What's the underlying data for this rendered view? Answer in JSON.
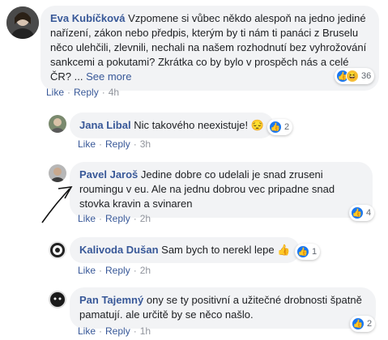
{
  "actions": {
    "like": "Like",
    "reply": "Reply",
    "dot": "·"
  },
  "comments": [
    {
      "author": "Eva Kubíčková",
      "text": "Vzpomene si vůbec někdo alespoň na jedno jediné nařízení, zákon nebo předpis, kterým by ti nám ti panáci z Bruselu něco ulehčili, zlevnili, nechali na našem rozhodnutí bez vyhrožování sankcemi a pokutami? Zkrátka co by bylo v prospěch nás a celé ČR? ...",
      "see_more": "See more",
      "time": "4h",
      "reaction_count": "36",
      "reactions": [
        "like-icon",
        "haha-icon"
      ]
    },
    {
      "author": "Jana Libal",
      "text": "Nic takového neexistuje!",
      "emoji": "😔",
      "time": "3h",
      "reaction_count": "2",
      "reactions": [
        "like-icon"
      ]
    },
    {
      "author": "Pavel Jaroš",
      "text": "Jedine dobre co udelali je snad zruseni roumingu v eu. Ale na jednu dobrou vec pripadne snad stovka kravin a svinaren",
      "time": "2h",
      "reaction_count": "4",
      "reactions": [
        "like-icon"
      ]
    },
    {
      "author": "Kalivoda Dušan",
      "text": "Sam bych to nerekl lepe",
      "emoji": "👍",
      "time": "2h",
      "reaction_count": "1",
      "reactions": [
        "like-icon"
      ]
    },
    {
      "author": "Pan Tajemný",
      "text": "ony se ty positivní a užitečné drobnosti špatně pamatují. ale určitě by se něco našlo.",
      "time": "1h",
      "reaction_count": "2",
      "reactions": [
        "like-icon"
      ]
    }
  ],
  "colors": {
    "link": "#385898",
    "bubble": "#f2f3f5",
    "meta": "#90949c",
    "like": "#1877f2"
  }
}
